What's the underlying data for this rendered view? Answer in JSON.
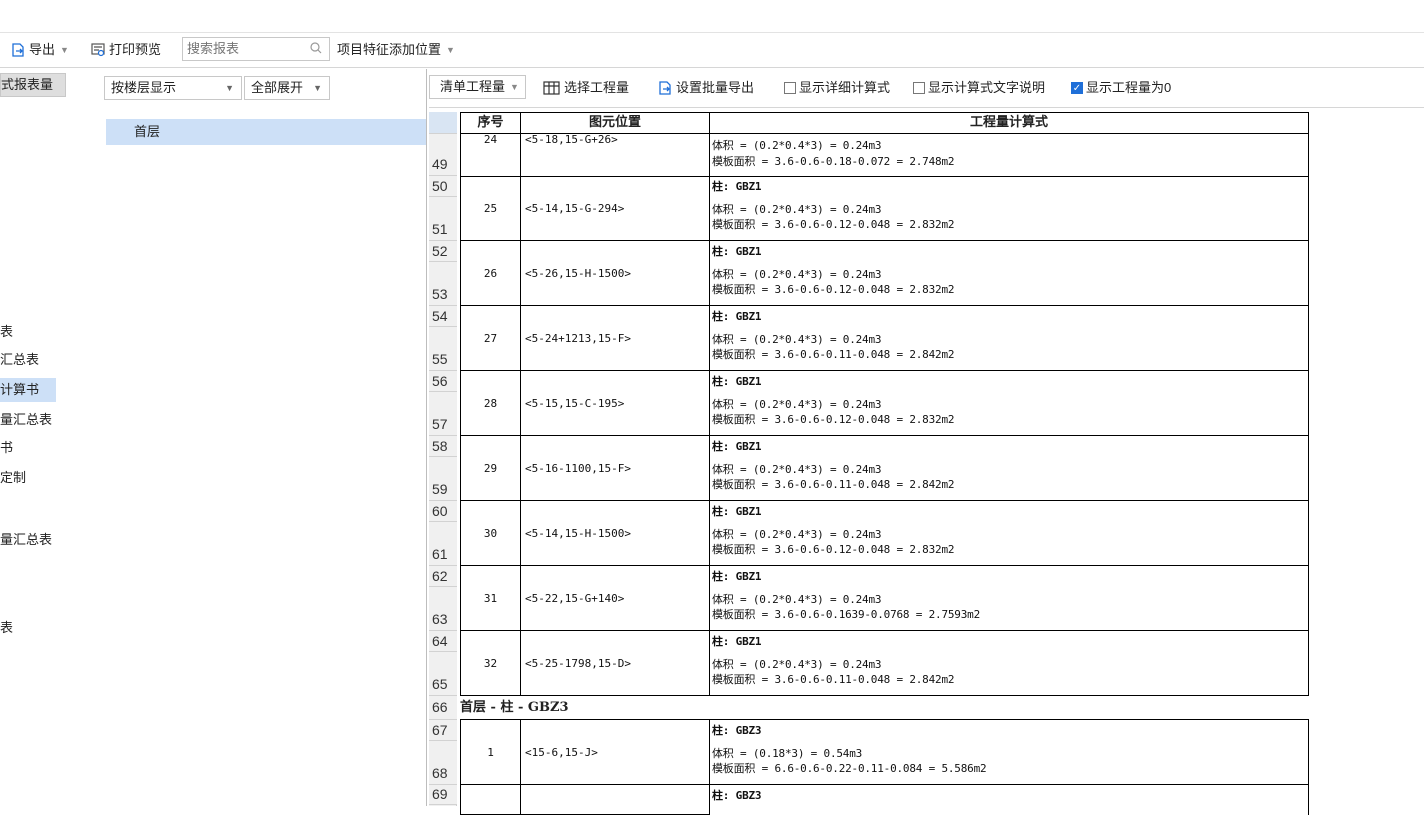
{
  "toolbar": {
    "export_label": "导出",
    "print_preview_label": "打印预览",
    "search_placeholder": "搜索报表",
    "project_feature_label": "项目特征添加位置"
  },
  "left_panel": {
    "header": "式报表量",
    "items": [
      "表",
      "汇总表",
      "计算书",
      "量汇总表",
      "书",
      "定制",
      "量汇总表",
      "表"
    ],
    "selected_index": 2
  },
  "mid_panel": {
    "floor_dropdown": "按楼层显示",
    "expand_dropdown": "全部展开",
    "tree_node": "首层"
  },
  "right_toolbar": {
    "qty_dropdown": "清单工程量",
    "select_qty": "选择工程量",
    "batch_export": "设置批量导出",
    "show_detail_formula": "显示详细计算式",
    "show_formula_text": "显示计算式文字说明",
    "show_zero_qty": "显示工程量为0",
    "checks": {
      "detail": false,
      "text": false,
      "zero": true
    }
  },
  "table": {
    "headers": [
      "序号",
      "图元位置",
      "工程量计算式"
    ],
    "row_numbers": [
      "49",
      "50",
      "51",
      "52",
      "53",
      "54",
      "55",
      "56",
      "57",
      "58",
      "59",
      "60",
      "61",
      "62",
      "63",
      "64",
      "65",
      "66",
      "67",
      "68",
      "69"
    ],
    "partial_top": {
      "seq": "24",
      "pos": "<5-18,15-G+26>",
      "lines": [
        "体积 = (0.2*0.4*3) = 0.24m3",
        "模板面积 = 3.6-0.6-0.18-0.072 = 2.748m2"
      ]
    },
    "groups": [
      {
        "seq": "25",
        "pos": "<5-14,15-G-294>",
        "title": "柱: GBZ1",
        "lines": [
          "体积 = (0.2*0.4*3) = 0.24m3",
          "模板面积 = 3.6-0.6-0.12-0.048 = 2.832m2"
        ]
      },
      {
        "seq": "26",
        "pos": "<5-26,15-H-1500>",
        "title": "柱: GBZ1",
        "lines": [
          "体积 = (0.2*0.4*3) = 0.24m3",
          "模板面积 = 3.6-0.6-0.12-0.048 = 2.832m2"
        ]
      },
      {
        "seq": "27",
        "pos": "<5-24+1213,15-F>",
        "title": "柱: GBZ1",
        "lines": [
          "体积 = (0.2*0.4*3) = 0.24m3",
          "模板面积 = 3.6-0.6-0.11-0.048 = 2.842m2"
        ]
      },
      {
        "seq": "28",
        "pos": "<5-15,15-C-195>",
        "title": "柱: GBZ1",
        "lines": [
          "体积 = (0.2*0.4*3) = 0.24m3",
          "模板面积 = 3.6-0.6-0.12-0.048 = 2.832m2"
        ]
      },
      {
        "seq": "29",
        "pos": "<5-16-1100,15-F>",
        "title": "柱: GBZ1",
        "lines": [
          "体积 = (0.2*0.4*3) = 0.24m3",
          "模板面积 = 3.6-0.6-0.11-0.048 = 2.842m2"
        ]
      },
      {
        "seq": "30",
        "pos": "<5-14,15-H-1500>",
        "title": "柱: GBZ1",
        "lines": [
          "体积 = (0.2*0.4*3) = 0.24m3",
          "模板面积 = 3.6-0.6-0.12-0.048 = 2.832m2"
        ]
      },
      {
        "seq": "31",
        "pos": "<5-22,15-G+140>",
        "title": "柱: GBZ1",
        "lines": [
          "体积 = (0.2*0.4*3) = 0.24m3",
          "模板面积 = 3.6-0.6-0.1639-0.0768 = 2.7593m2"
        ]
      },
      {
        "seq": "32",
        "pos": "<5-25-1798,15-D>",
        "title": "柱: GBZ1",
        "lines": [
          "体积 = (0.2*0.4*3) = 0.24m3",
          "模板面积 = 3.6-0.6-0.11-0.048 = 2.842m2"
        ]
      }
    ],
    "section_title": "首层 - 柱 - GBZ3",
    "group_after": {
      "seq": "1",
      "pos": "<15-6,15-J>",
      "title": "柱: GBZ3",
      "lines": [
        "体积 = (0.18*3) = 0.54m3",
        "模板面积 = 6.6-0.6-0.22-0.11-0.084 = 5.586m2"
      ]
    },
    "partial_bottom": {
      "title": "柱: GBZ3"
    }
  }
}
